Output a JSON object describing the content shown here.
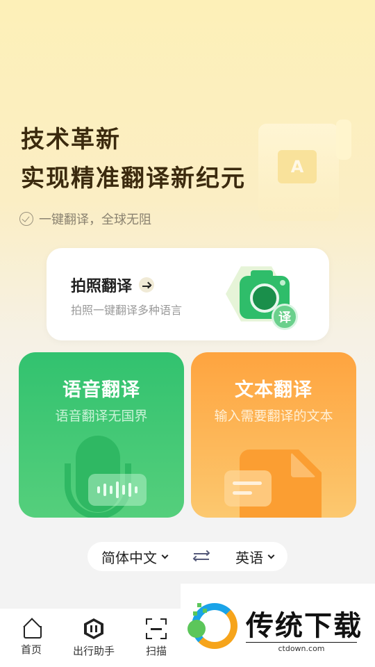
{
  "hero": {
    "line1": "技术革新",
    "line2": "实现精准翻译新纪元",
    "tagline": "一键翻译，全球无阻"
  },
  "illustration": {
    "bubble_letter": "A"
  },
  "photo_translate": {
    "title": "拍照翻译",
    "subtitle": "拍照一键翻译多种语言",
    "badge": "译"
  },
  "voice_translate": {
    "title": "语音翻译",
    "subtitle": "语音翻译无国界"
  },
  "text_translate": {
    "title": "文本翻译",
    "subtitle": "输入需要翻译的文本"
  },
  "language_bar": {
    "source": "简体中文",
    "target": "英语"
  },
  "bottom_nav": {
    "items": [
      {
        "label": "首页",
        "icon": "home-icon"
      },
      {
        "label": "出行助手",
        "icon": "travel-assistant-icon"
      },
      {
        "label": "扫描",
        "icon": "scan-icon"
      }
    ]
  },
  "watermark": {
    "title": "传统下载",
    "url": "ctdown.com"
  },
  "colors": {
    "voice_card": "#32c26f",
    "text_card": "#fea43f",
    "camera_green": "#2fbd6a",
    "hero_text": "#3b2a0e"
  }
}
